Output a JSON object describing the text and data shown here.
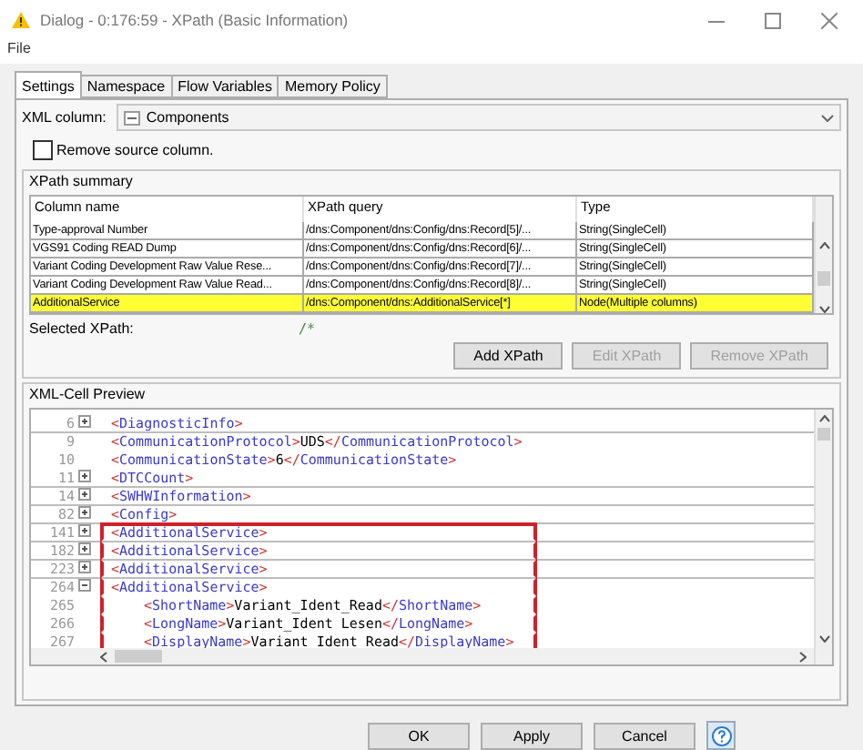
{
  "window": {
    "title": "Dialog - 0:176:59 - XPath (Basic Information)"
  },
  "menu": [
    "File"
  ],
  "tabs": [
    {
      "label": "Settings",
      "selected": true
    },
    {
      "label": "Namespace",
      "selected": false
    },
    {
      "label": "Flow Variables",
      "selected": false
    },
    {
      "label": "Memory Policy",
      "selected": false
    }
  ],
  "xml_column": {
    "label": "XML column:",
    "value": "Components"
  },
  "remove_source": {
    "label": "Remove source column.",
    "checked": false
  },
  "xpath_summary": {
    "title": "XPath summary",
    "columns": [
      "Column name",
      "XPath query",
      "Type"
    ],
    "rows": [
      {
        "cells": [
          "Type-approval Number",
          "/dns:Component/dns:Config/dns:Record[5]/...",
          "String(SingleCell)"
        ],
        "selected": false
      },
      {
        "cells": [
          "VGS91 Coding READ Dump",
          "/dns:Component/dns:Config/dns:Record[6]/...",
          "String(SingleCell)"
        ],
        "selected": false
      },
      {
        "cells": [
          "Variant Coding Development Raw Value Rese...",
          "/dns:Component/dns:Config/dns:Record[7]/...",
          "String(SingleCell)"
        ],
        "selected": false
      },
      {
        "cells": [
          "Variant Coding Development Raw Value Read...",
          "/dns:Component/dns:Config/dns:Record[8]/...",
          "String(SingleCell)"
        ],
        "selected": false
      },
      {
        "cells": [
          "AdditionalService",
          "/dns:Component/dns:AdditionalService[*]",
          "Node(Multiple columns)"
        ],
        "selected": true
      }
    ],
    "selected_xpath": {
      "label": "Selected XPath:",
      "value": "/*"
    },
    "buttons": [
      {
        "label": "Add XPath",
        "disabled": false
      },
      {
        "label": "Edit XPath",
        "disabled": true
      },
      {
        "label": "Remove XPath",
        "disabled": true
      }
    ]
  },
  "preview": {
    "title": "XML-Cell Preview",
    "lines": [
      {
        "number": "6",
        "kind": "node",
        "expanded": false,
        "text": "<DiagnosticInfo>",
        "highlighted": false
      },
      {
        "number": "9",
        "kind": "leaf",
        "text": "<CommunicationProtocol>UDS</CommunicationProtocol>",
        "highlighted": false
      },
      {
        "number": "10",
        "kind": "leaf",
        "text": "<CommunicationState>6</CommunicationState>",
        "highlighted": false
      },
      {
        "number": "11",
        "kind": "node",
        "expanded": false,
        "text": "<DTCCount>",
        "highlighted": false
      },
      {
        "number": "14",
        "kind": "node",
        "expanded": false,
        "text": "<SWHWInformation>",
        "highlighted": false
      },
      {
        "number": "82",
        "kind": "node",
        "expanded": false,
        "text": "<Config>",
        "highlighted": false
      },
      {
        "number": "141",
        "kind": "node",
        "expanded": false,
        "text": "<AdditionalService>",
        "highlighted": true
      },
      {
        "number": "182",
        "kind": "node",
        "expanded": false,
        "text": "<AdditionalService>",
        "highlighted": true
      },
      {
        "number": "223",
        "kind": "node",
        "expanded": false,
        "text": "<AdditionalService>",
        "highlighted": true
      },
      {
        "number": "264",
        "kind": "node",
        "expanded": true,
        "text": "<AdditionalService>",
        "highlighted": true,
        "children": [
          {
            "number": "265",
            "kind": "leaf",
            "text": "<ShortName>Variant_Ident_Read</ShortName>",
            "highlighted": true
          },
          {
            "number": "266",
            "kind": "leaf",
            "text": "<LongName>Variant_Ident Lesen</LongName>",
            "highlighted": true
          },
          {
            "number": "267",
            "kind": "leaf",
            "text": "<DisplayName>Variant_Ident_Read</DisplayName>",
            "highlighted": true
          }
        ]
      }
    ]
  },
  "footer_buttons": [
    "OK",
    "Apply",
    "Cancel"
  ]
}
